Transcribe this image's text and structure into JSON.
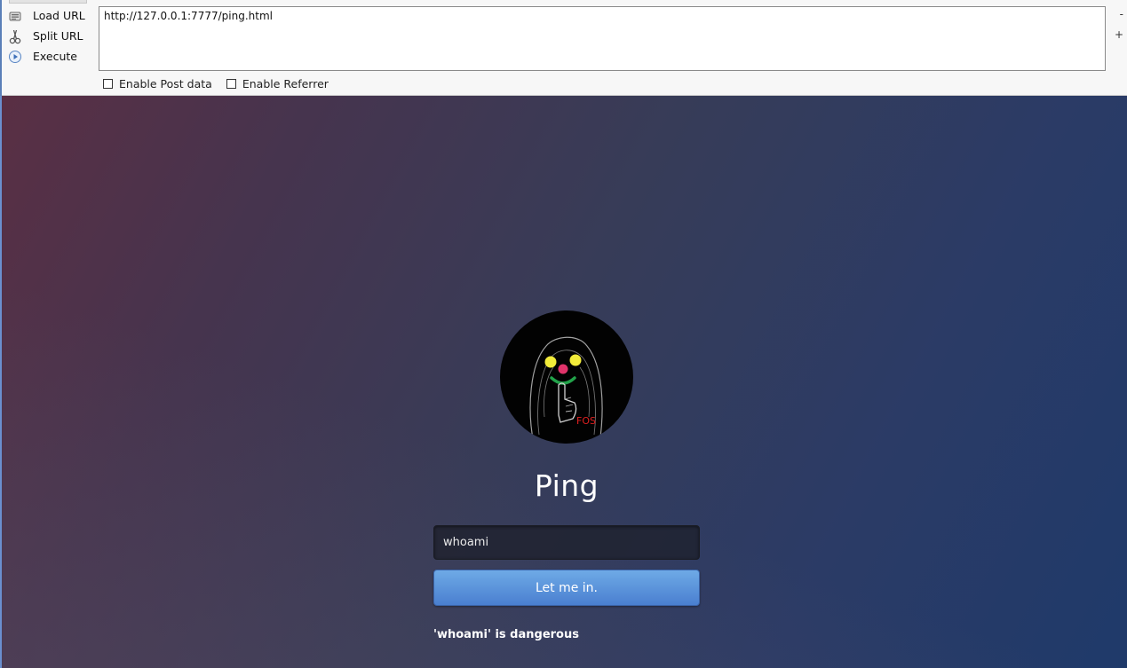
{
  "hackbar": {
    "actions": [
      {
        "label": "Load URL",
        "icon": "load-url-icon"
      },
      {
        "label": "Split URL",
        "icon": "split-url-icon"
      },
      {
        "label": "Execute",
        "icon": "execute-icon"
      }
    ],
    "url": "http://127.0.0.1:7777/ping.html",
    "minus_label": "-",
    "plus_label": "+",
    "checkboxes": [
      {
        "label": "Enable Post data",
        "checked": false
      },
      {
        "label": "Enable Referrer",
        "checked": false
      }
    ]
  },
  "page": {
    "logo": {
      "icon": "hooded-figure-logo",
      "text": "FOS"
    },
    "title": "Ping",
    "input_value": "whoami",
    "button_label": "Let me in.",
    "result_text": "'whoami' is dangerous"
  }
}
